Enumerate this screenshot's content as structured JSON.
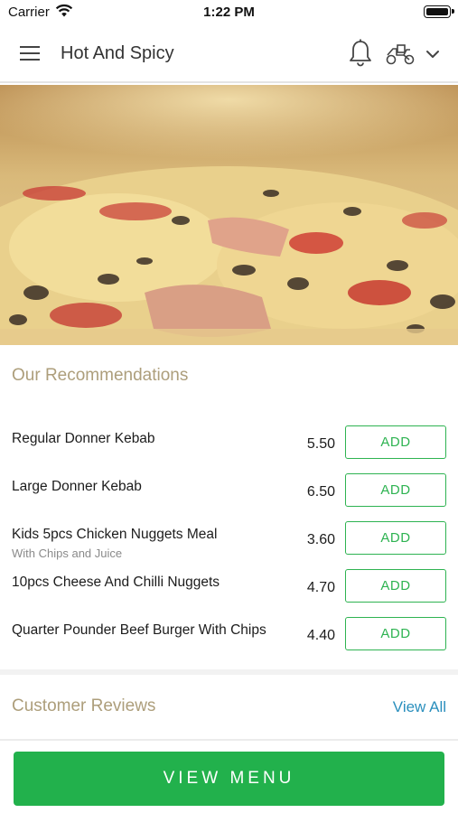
{
  "status_bar": {
    "carrier": "Carrier",
    "time": "1:22 PM"
  },
  "header": {
    "title": "Hot And Spicy"
  },
  "icons": {
    "menu": "menu-icon",
    "notification": "bell-icon",
    "delivery": "scooter-icon",
    "dropdown": "chevron-down-icon",
    "wifi": "wifi-icon",
    "battery": "battery-icon"
  },
  "recommendations": {
    "title": "Our Recommendations",
    "items": [
      {
        "name": "Regular Donner Kebab",
        "subtitle": "",
        "price": "5.50",
        "button": "ADD"
      },
      {
        "name": "Large Donner Kebab",
        "subtitle": "",
        "price": "6.50",
        "button": "ADD"
      },
      {
        "name": "Kids 5pcs Chicken Nuggets Meal",
        "subtitle": "With Chips and Juice",
        "price": "3.60",
        "button": "ADD"
      },
      {
        "name": "10pcs Cheese And Chilli Nuggets",
        "subtitle": "",
        "price": "4.70",
        "button": "ADD"
      },
      {
        "name": "Quarter Pounder Beef Burger With Chips",
        "subtitle": "",
        "price": "4.40",
        "button": "ADD"
      }
    ]
  },
  "reviews": {
    "title": "Customer Reviews",
    "view_all": "View All"
  },
  "bottom": {
    "button": "VIEW MENU"
  },
  "colors": {
    "accent_green": "#22b14c",
    "section_title": "#ad9e7b",
    "link_blue": "#2a8fbd"
  }
}
